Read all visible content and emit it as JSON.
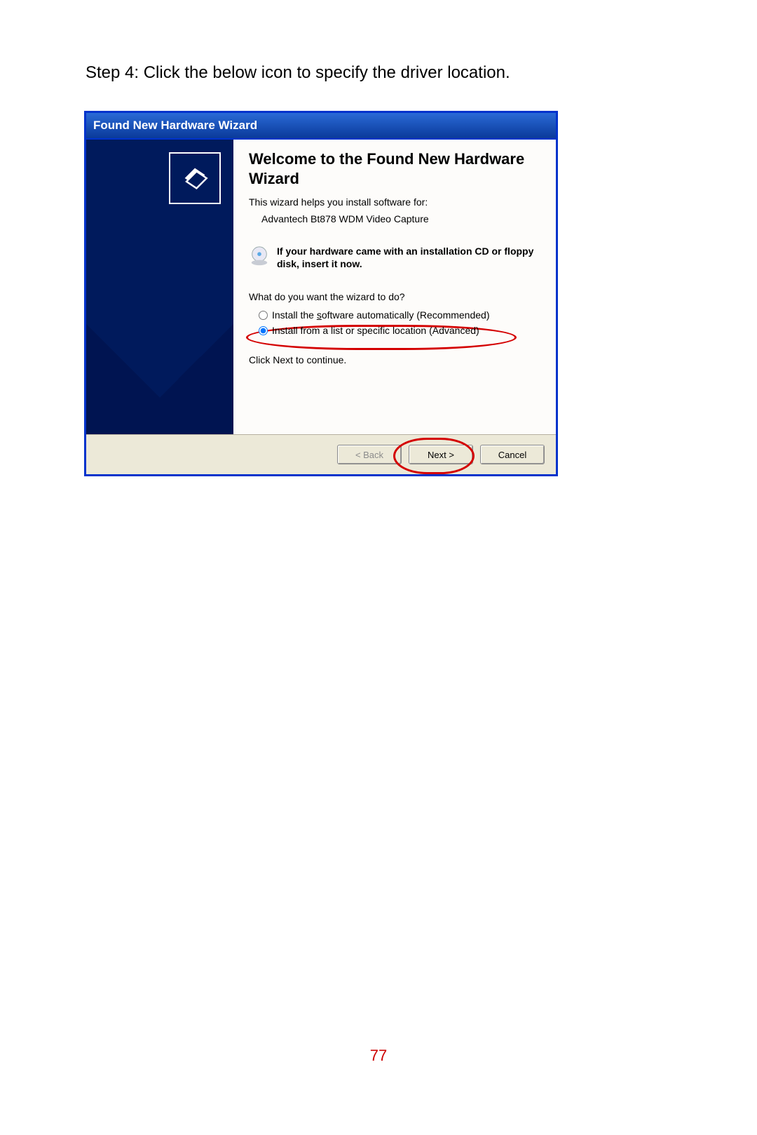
{
  "doc": {
    "step_text": "Step 4: Click the below icon to specify the driver location.",
    "page_number": "77"
  },
  "wizard": {
    "title": "Found New Hardware Wizard",
    "welcome": "Welcome to the Found New Hardware Wizard",
    "intro": "This wizard helps you install software for:",
    "device": "Advantech Bt878 WDM Video Capture",
    "cd_note": "If your hardware came with an installation CD or floppy disk, insert it now.",
    "prompt": "What do you want the wizard to do?",
    "options": {
      "auto_prefix": "Install the ",
      "auto_s": "s",
      "auto_suffix": "oftware automatically (Recommended)",
      "advanced": "Install from a list or specific location (Advanced)"
    },
    "continue": "Click Next to continue.",
    "buttons": {
      "back": "< Back",
      "next": "Next >",
      "cancel": "Cancel"
    }
  }
}
